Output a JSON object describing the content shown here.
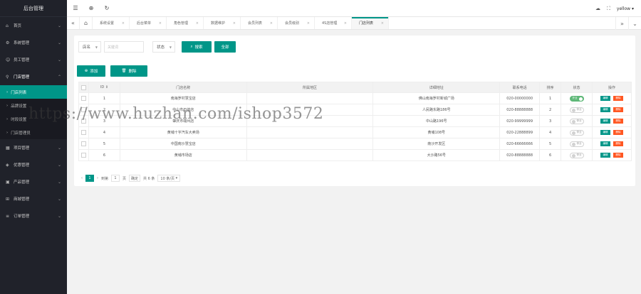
{
  "app": {
    "title": "后台管理"
  },
  "sidebar": {
    "items": [
      {
        "icon": "home-icon",
        "label": "首页"
      },
      {
        "icon": "gear-icon",
        "label": "系统管理"
      },
      {
        "icon": "user-icon",
        "label": "员工管理"
      },
      {
        "icon": "location-icon",
        "label": "门店管理",
        "open": true,
        "children": [
          {
            "label": "门店列表",
            "active": true
          },
          {
            "label": "品牌设置"
          },
          {
            "label": "时段设置"
          },
          {
            "label": "门店管理员"
          }
        ]
      },
      {
        "icon": "grid-icon",
        "label": "项目管理"
      },
      {
        "icon": "tag-icon",
        "label": "优惠管理"
      },
      {
        "icon": "box-icon",
        "label": "产品管理"
      },
      {
        "icon": "cart-icon",
        "label": "商城管理"
      },
      {
        "icon": "order-icon",
        "label": "订单管理"
      }
    ]
  },
  "header": {
    "username": "yellow"
  },
  "tabs": [
    {
      "label": "系统设置"
    },
    {
      "label": "后台菜单"
    },
    {
      "label": "角色管理"
    },
    {
      "label": "数据维护"
    },
    {
      "label": "会员列表"
    },
    {
      "label": "会员级别"
    },
    {
      "label": "4S店管理"
    },
    {
      "label": "门店列表",
      "active": true
    }
  ],
  "search": {
    "field_select": "店名",
    "keyword_placeholder": "关键词",
    "status_select": "状态",
    "search_label": "搜索",
    "all_label": "全部"
  },
  "actions": {
    "add_label": "添加",
    "delete_label": "删除"
  },
  "table": {
    "headers": [
      "ID",
      "门店名称",
      "所属地区",
      "详细地址",
      "联系电话",
      "排序",
      "状态",
      "操作"
    ],
    "edit_label": "编辑",
    "delete_label": "删除",
    "switch_on_label": "开业",
    "switch_off_label": "停业",
    "rows": [
      {
        "id": "1",
        "name": "南海罗村慧宝店",
        "region": "",
        "address": "佛山南海罗村新城广场",
        "phone": "020-00000000",
        "sort": "1",
        "on": true
      },
      {
        "id": "2",
        "name": "中山市石岐店",
        "region": "",
        "address": "人民路东路186号",
        "phone": "020-88888888",
        "sort": "2",
        "on": false
      },
      {
        "id": "3",
        "name": "肇庆市端州店",
        "region": "",
        "address": "中山路196号",
        "phone": "020-99999999",
        "sort": "3",
        "on": false
      },
      {
        "id": "4",
        "name": "黄埔十字汽车大卖场",
        "region": "",
        "address": "黄埔108号",
        "phone": "020-22888899",
        "sort": "4",
        "on": false
      },
      {
        "id": "5",
        "name": "中国南沙慧宝店",
        "region": "",
        "address": "南沙开发区",
        "phone": "020-66666666",
        "sort": "5",
        "on": false
      },
      {
        "id": "6",
        "name": "黄埔市场店",
        "region": "",
        "address": "大沙路56号",
        "phone": "020-88888888",
        "sort": "6",
        "on": false
      }
    ]
  },
  "pager": {
    "current": "1",
    "goto_label": "到第",
    "goto_value": "1",
    "page_unit": "页",
    "confirm_label": "确定",
    "total_label": "共 6 条",
    "per_page": "10 条/页"
  },
  "watermark": "https://www.huzhan.com/ishop3572"
}
